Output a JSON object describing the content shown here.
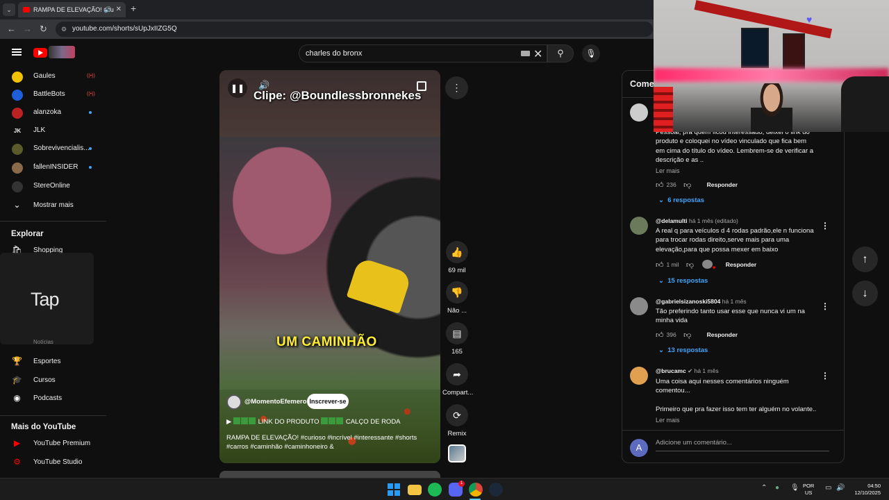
{
  "browser": {
    "tab_title": "RAMPA DE ELEVAÇÃO! #cu",
    "url": "youtube.com/shorts/sUpJxIIZG5Q"
  },
  "search": {
    "query": "charles do bronx"
  },
  "sidebar": {
    "subscriptions": [
      {
        "name": "Gaules",
        "indicator": "live",
        "avatar_color": "#f2c200"
      },
      {
        "name": "BattleBots",
        "indicator": "live",
        "avatar_color": "#1e5fd9"
      },
      {
        "name": "alanzoka",
        "indicator": "dot",
        "avatar_color": "#b22"
      },
      {
        "name": "JLK",
        "indicator": "none",
        "avatar_color": "#0f0f0f"
      },
      {
        "name": "Sobrevivencialis...",
        "indicator": "dot",
        "avatar_color": "#5a5a2a"
      },
      {
        "name": "fallenINSIDER",
        "indicator": "dot",
        "avatar_color": "#8a6a4a"
      },
      {
        "name": "StereOnline",
        "indicator": "none",
        "avatar_color": "#333"
      }
    ],
    "show_more": "Mostrar mais",
    "explore_title": "Explorar",
    "explore_items": [
      {
        "label": "Shopping",
        "icon": "shopping-bag-icon"
      },
      {
        "label": "Esportes",
        "icon": "trophy-icon"
      },
      {
        "label": "Cursos",
        "icon": "graduation-cap-icon"
      },
      {
        "label": "Podcasts",
        "icon": "podcast-icon"
      }
    ],
    "hidden_item": "Notícias",
    "more_title": "Mais do YouTube",
    "more_items": [
      {
        "label": "YouTube Premium",
        "icon": "youtube-premium-icon"
      },
      {
        "label": "YouTube Studio",
        "icon": "youtube-studio-icon"
      }
    ]
  },
  "tap_overlay": "Tap",
  "short": {
    "clip_credit": "Clipe: @Boundlessbronnekes",
    "caption": "UM CAMINHÃO",
    "channel": "@MomentoEfemero",
    "subscribe": "Inscrever-se",
    "link_text": "LINK DO PRODUTO",
    "link_text2": "CALÇO DE RODA",
    "description": "RAMPA DE ELEVAÇÃO! #curioso #incrível #interessante #shorts #carros #caminhão #caminhoneiro &"
  },
  "actions": {
    "likes": "69 mil",
    "dislike": "Não ...",
    "comments": "165",
    "share": "Compart...",
    "remix": "Remix"
  },
  "comments": {
    "title": "Comer",
    "items": [
      {
        "body": "Pessoal, pra quem ficou interessado, deixei o link do produto e coloquei no vídeo vinculado que fica bem em cima do título do vídeo. Lembrem-se de verificar a descrição e as ..",
        "more": "Ler mais",
        "likes": "236",
        "reply": "Responder",
        "replies": "6 respostas"
      },
      {
        "author": "@delamulti",
        "meta": "há 1 mês (editado)",
        "body": "A real q para veículos d 4 rodas padrão,ele n funciona para trocar rodas direito,serve mais para uma elevação,para que possa mexer em baixo",
        "likes": "1 mil",
        "reply": "Responder",
        "replies": "15 respostas"
      },
      {
        "author": "@gabrielsizanoski5804",
        "meta": "há 1 mês",
        "body": "Tão preferindo tanto usar esse que nunca vi um na minha vida",
        "likes": "396",
        "reply": "Responder",
        "replies": "13 respostas"
      },
      {
        "author": "@brucamc",
        "meta": "há 1 mês",
        "body": "Uma coisa aqui nesses comentários ninguém comentou...",
        "body2": "Primeiro que pra fazer isso tem ter alguém no volante..",
        "more": "Ler mais"
      }
    ],
    "add_avatar": "A",
    "add_placeholder": "Adicione um comentário..."
  },
  "taskbar": {
    "lang1": "POR",
    "lang2": "US",
    "time": "04:50",
    "date": "12/10/2025",
    "discord_badge": "1"
  },
  "colors": {
    "accent_blue": "#3ea6ff",
    "youtube_red": "#ff0000",
    "caption_yellow": "#ffee33"
  }
}
